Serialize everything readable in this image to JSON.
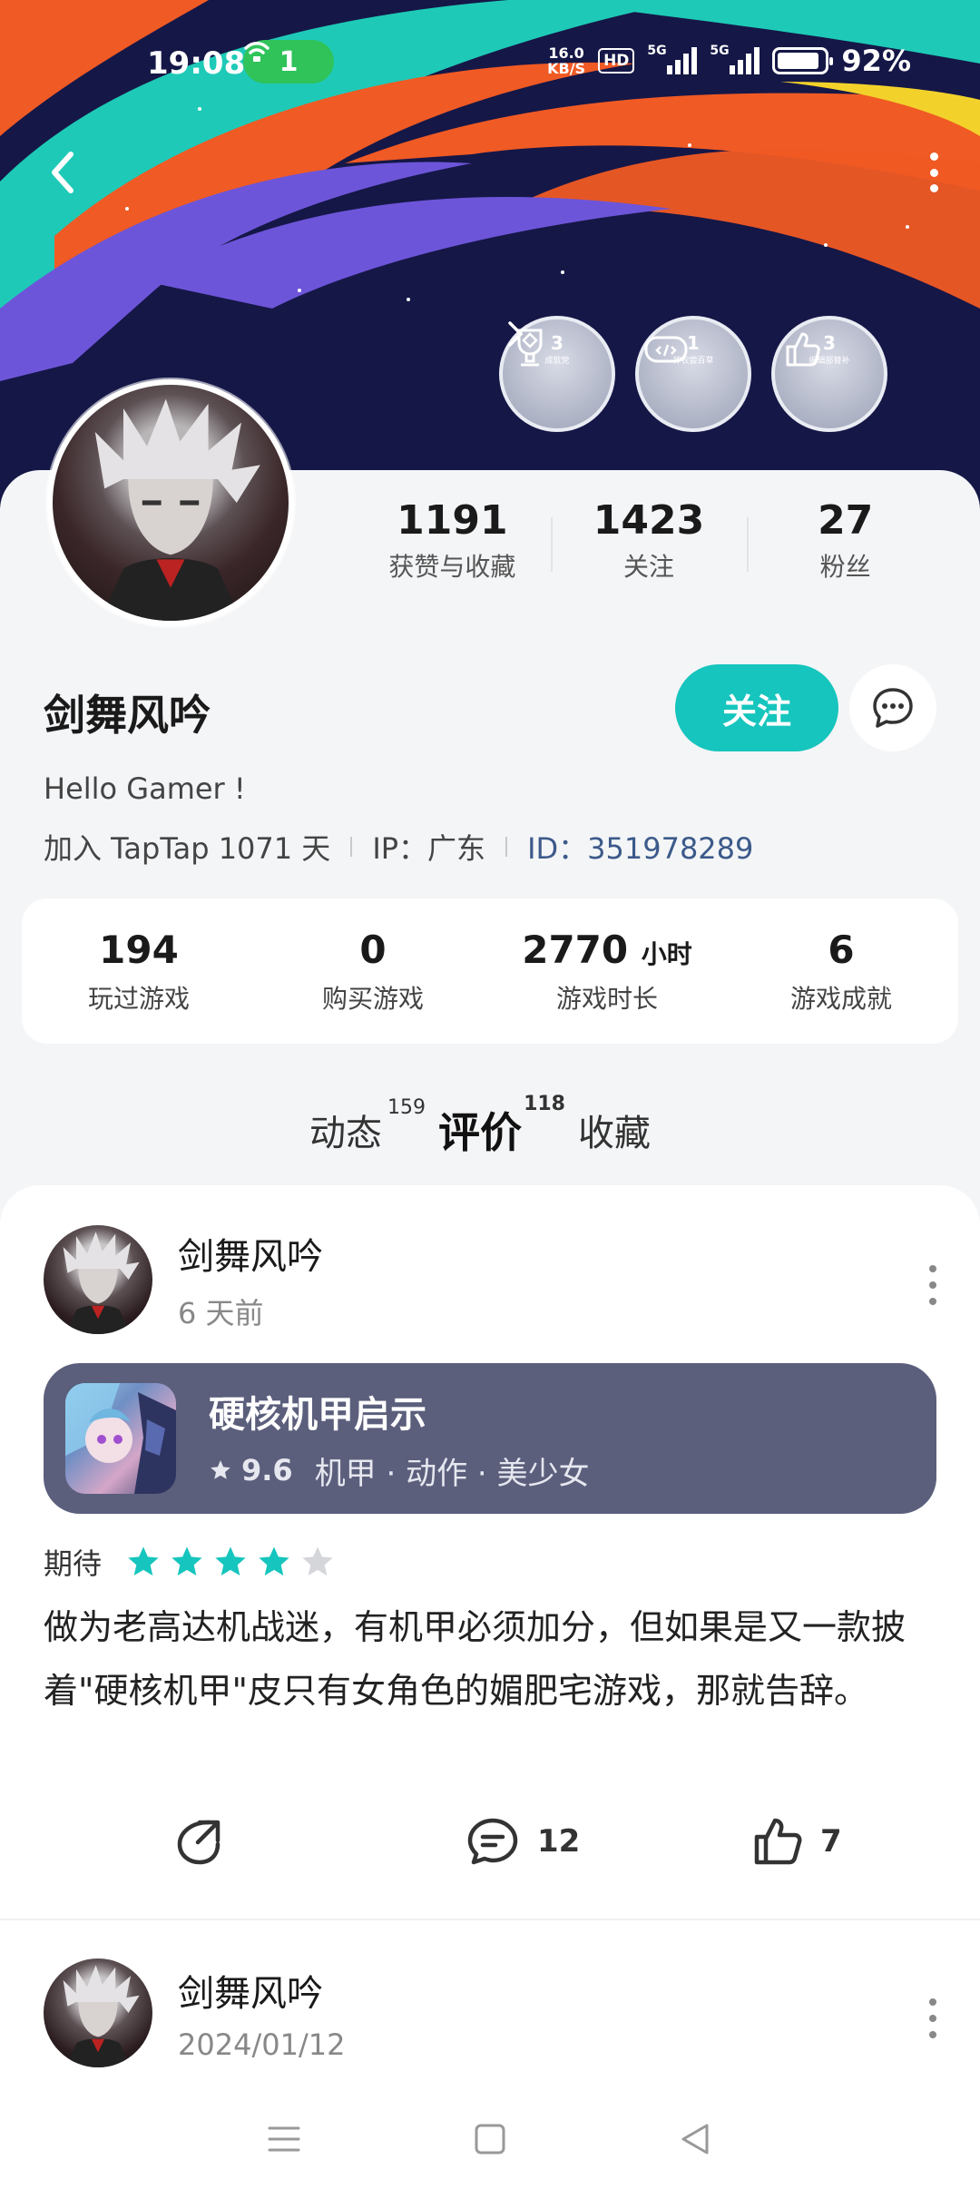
{
  "status_bar": {
    "time": "19:08",
    "hotspot_count": "1",
    "net_speed_value": "16.0",
    "net_speed_unit": "KB/S",
    "hd_label": "HD",
    "sim1_tag": "5G",
    "sim2_tag": "5G",
    "battery": "92%"
  },
  "badges": [
    {
      "num": "3",
      "cap": "成就党",
      "icon": "trophy-icon"
    },
    {
      "num": "1",
      "cap": "神农尝百草",
      "icon": "gamepad-icon"
    },
    {
      "num": "3",
      "cap": "编辑部替补",
      "icon": "thumbs-up-icon"
    }
  ],
  "profile": {
    "stats": [
      {
        "value": "1191",
        "label": "获赞与收藏"
      },
      {
        "value": "1423",
        "label": "关注"
      },
      {
        "value": "27",
        "label": "粉丝"
      }
    ],
    "name": "剑舞风吟",
    "follow_label": "关注",
    "bio": "Hello Gamer !",
    "joined": "加入 TapTap 1071 天",
    "ip": "IP：广东",
    "id": "ID：351978289"
  },
  "game_stats": [
    {
      "value": "194",
      "unit": "",
      "label": "玩过游戏"
    },
    {
      "value": "0",
      "unit": "",
      "label": "购买游戏"
    },
    {
      "value": "2770",
      "unit": "小时",
      "label": "游戏时长"
    },
    {
      "value": "6",
      "unit": "",
      "label": "游戏成就"
    }
  ],
  "tabs": [
    {
      "label": "动态",
      "count": "159",
      "active": false
    },
    {
      "label": "评价",
      "count": "118",
      "active": true
    },
    {
      "label": "收藏",
      "count": "",
      "active": false
    }
  ],
  "posts": [
    {
      "author": "剑舞风吟",
      "time": "6 天前",
      "game": {
        "title": "硬核机甲启示",
        "score": "9.6",
        "tags": "机甲 · 动作 · 美少女"
      },
      "rating_label": "期待",
      "rating_stars": 4,
      "rating_max": 5,
      "text": "做为老高达机战迷，有机甲必须加分，但如果是又一款披着\"硬核机甲\"皮只有女角色的媚肥宅游戏，那就告辞。",
      "comments": "12",
      "likes": "7"
    },
    {
      "author": "剑舞风吟",
      "time": "2024/01/12"
    }
  ],
  "colors": {
    "accent": "#16c5bd",
    "banner_bg": "#151747",
    "game_card": "#5b5f7c",
    "id_link": "#3c5a8a"
  }
}
